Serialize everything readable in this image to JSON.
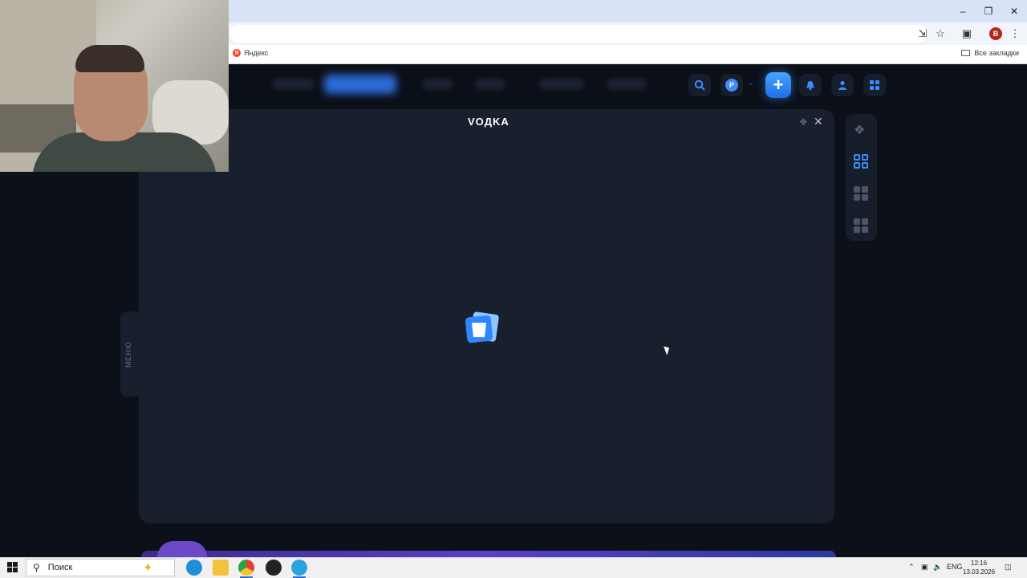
{
  "browser": {
    "bookmark_yandex": "Яндекс",
    "bookmark_all": "Все закладки",
    "profile_initial": "B"
  },
  "site": {
    "logo": "VOДKA",
    "menu_tab": "МЕНЮ",
    "coin_letter": "P"
  },
  "taskbar": {
    "search_label": "Поиск",
    "lang": "ENG",
    "time": "12:16",
    "date": "13.03.2026"
  },
  "colors": {
    "accent": "#3c8cff",
    "modal_bg": "#18202e",
    "page_bg": "#0c1019"
  }
}
